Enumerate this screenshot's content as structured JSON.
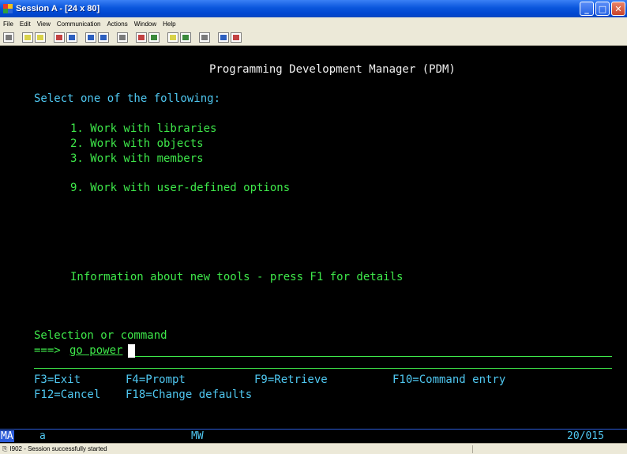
{
  "window": {
    "title": "Session A - [24 x 80]",
    "icon": "session-icon",
    "controls": [
      "minimize",
      "maximize",
      "close"
    ]
  },
  "menu": [
    {
      "label": "File"
    },
    {
      "label": "Edit"
    },
    {
      "label": "View"
    },
    {
      "label": "Communication"
    },
    {
      "label": "Actions"
    },
    {
      "label": "Window"
    },
    {
      "label": "Help"
    }
  ],
  "screen": {
    "title": "Programming Development Manager (PDM)",
    "prompt": "Select one of the following:",
    "options": [
      "1. Work with libraries",
      "2. Work with objects",
      "3. Work with members",
      "9. Work with user-defined options"
    ],
    "info": "Information about new tools - press F1 for details",
    "selection_label": "Selection or command",
    "arrow": "===>",
    "command_value": "go power",
    "function_keys_row1": [
      "F3=Exit",
      "F4=Prompt",
      "F9=Retrieve",
      "F10=Command entry"
    ],
    "function_keys_row2": [
      "F12=Cancel",
      "F18=Change defaults"
    ]
  },
  "status_line": {
    "indicator": "MA",
    "field1": "a",
    "field2": "MW",
    "position": "20/015"
  },
  "statusbar": {
    "message": "I902 - Session successfully started"
  },
  "colors": {
    "text_green": "#3ee84a",
    "text_white": "#f0f0f0",
    "status_cyan": "#4fc7f0",
    "titlebar_blue": "#0a56dc"
  }
}
